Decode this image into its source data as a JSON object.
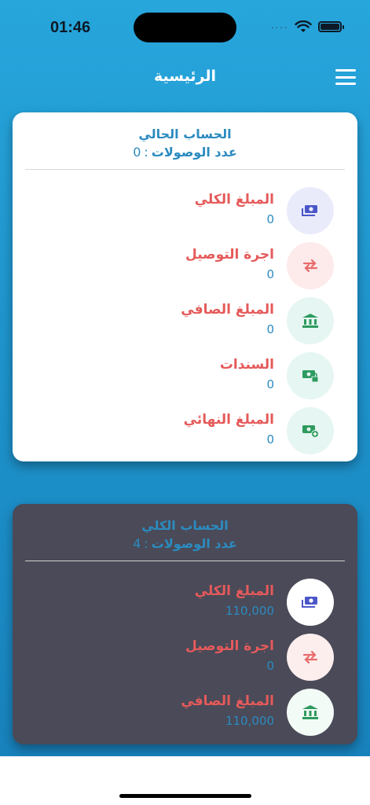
{
  "status": {
    "time": "01:46",
    "dots": "····"
  },
  "header": {
    "title": "الرئيسية"
  },
  "current": {
    "title": "الحساب الحالي",
    "count_label": "عدد الوصولات",
    "count_sep": ":",
    "count_value": "0",
    "rows": [
      {
        "label": "المبلغ الكلي",
        "value": "0",
        "icon": "money-icon",
        "color": "#4b57c9"
      },
      {
        "label": "اجرة التوصيل",
        "value": "0",
        "icon": "exchange-icon",
        "color": "#e86a6a"
      },
      {
        "label": "المبلغ الصافي",
        "value": "0",
        "icon": "bank-icon",
        "color": "#2e9b5e"
      },
      {
        "label": "السندات",
        "value": "0",
        "icon": "money-lock-icon",
        "color": "#2e9b5e"
      },
      {
        "label": "المبلغ النهائي",
        "value": "0",
        "icon": "money-plus-icon",
        "color": "#2e9b5e"
      }
    ]
  },
  "total": {
    "title": "الحساب الكلي",
    "count_label": "عدد الوصولات",
    "count_sep": ":",
    "count_value": "4",
    "rows": [
      {
        "label": "المبلغ الكلي",
        "value": "110,000",
        "icon": "money-icon",
        "color": "#4b57c9"
      },
      {
        "label": "اجرة التوصيل",
        "value": "0",
        "icon": "exchange-icon",
        "color": "#e86a6a"
      },
      {
        "label": "المبلغ الصافي",
        "value": "110,000",
        "icon": "bank-icon",
        "color": "#2e9b5e"
      }
    ]
  }
}
